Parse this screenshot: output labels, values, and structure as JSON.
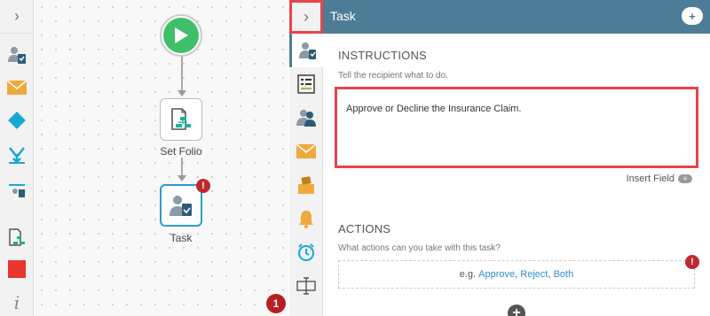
{
  "toolbox": {
    "toggle": "›",
    "items": [
      {
        "name": "user-task-icon"
      },
      {
        "name": "email-icon"
      },
      {
        "name": "decision-icon"
      },
      {
        "name": "merge-icon"
      },
      {
        "name": "workflow-tools-icon"
      },
      {
        "name": "set-folio-icon"
      },
      {
        "name": "end-icon"
      },
      {
        "name": "info-icon"
      }
    ]
  },
  "canvas": {
    "nodes": {
      "set_folio": "Set Folio",
      "task": "Task"
    },
    "task_error": "!",
    "error_count": "1"
  },
  "panel": {
    "collapse": "›",
    "title": "Task",
    "header_button": "+",
    "instructions": {
      "heading": "INSTRUCTIONS",
      "hint": "Tell the recipient what to do.",
      "value": "Approve or Decline the Insurance Claim.",
      "insert_field": "Insert Field",
      "insert_pill": "+"
    },
    "actions": {
      "heading": "ACTIONS",
      "hint": "What actions can you take with this task?",
      "prefix": "e.g.",
      "approve": "Approve",
      "reject": "Reject",
      "both": "Both",
      "sep1": ",",
      "sep2": ",",
      "error": "!",
      "add": "+"
    }
  },
  "colors": {
    "header": "#4d7d96",
    "start": "#3fbf6a",
    "highlight": "#e8424a",
    "error": "#c0282d",
    "link": "#2b8fd0"
  }
}
